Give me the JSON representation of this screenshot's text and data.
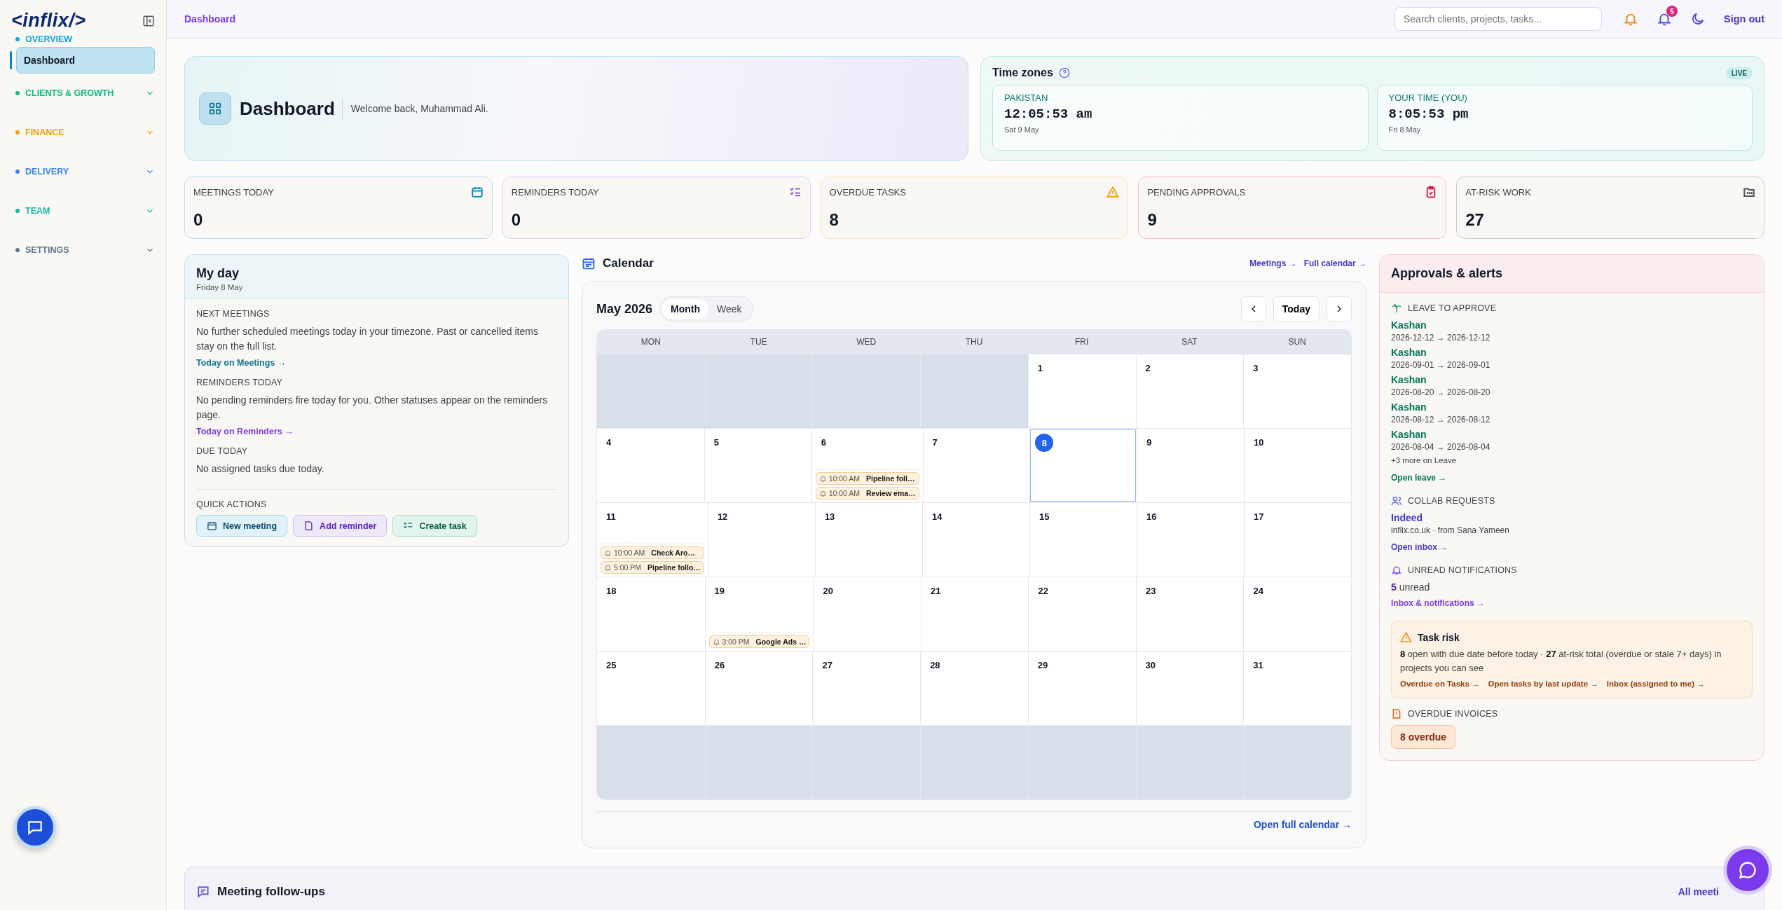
{
  "sidebar": {
    "logo": "<inflix/>",
    "sections": [
      {
        "label": "OVERVIEW",
        "color": "#0ea5e9",
        "expanded": true,
        "items": [
          {
            "label": "Dashboard",
            "selected": true
          }
        ]
      },
      {
        "label": "CLIENTS & GROWTH",
        "color": "#10b981",
        "expanded": false
      },
      {
        "label": "FINANCE",
        "color": "#f59e0b",
        "expanded": false
      },
      {
        "label": "DELIVERY",
        "color": "#3b82f6",
        "expanded": false
      },
      {
        "label": "TEAM",
        "color": "#14b8a6",
        "expanded": false
      },
      {
        "label": "SETTINGS",
        "color": "#64748b",
        "expanded": false
      }
    ]
  },
  "header": {
    "breadcrumb": "Dashboard",
    "search": {
      "placeholder": "Search clients, projects, tasks..."
    },
    "notification_count": "5",
    "sign_out": "Sign out"
  },
  "hero": {
    "title": "Dashboard",
    "subtitle": "Welcome back, Muhammad Ali."
  },
  "time_zones": {
    "title": "Time zones",
    "badge": "LIVE",
    "zones": [
      {
        "label": "PAKISTAN",
        "time": "12:05:53 am",
        "date": "Sat 9 May"
      },
      {
        "label": "YOUR TIME (YOU)",
        "time": "8:05:53 pm",
        "date": "Fri 8 May"
      }
    ]
  },
  "stats": [
    {
      "label": "MEETINGS TODAY",
      "value": "0",
      "kind": "calendar",
      "color": "#0891b2"
    },
    {
      "label": "REMINDERS TODAY",
      "value": "0",
      "kind": "checklist",
      "color": "#8b5cf6"
    },
    {
      "label": "OVERDUE TASKS",
      "value": "8",
      "kind": "warning",
      "color": "#f59e0b"
    },
    {
      "label": "PENDING APPROVALS",
      "value": "9",
      "kind": "clipboard",
      "color": "#e11d48"
    },
    {
      "label": "AT-RISK WORK",
      "value": "27",
      "kind": "folder",
      "color": "#52525b"
    }
  ],
  "my_day": {
    "title": "My day",
    "date": "Friday 8 May",
    "sections": [
      {
        "kind": "meetings",
        "heading": "NEXT MEETINGS",
        "text": "No further scheduled meetings today in your timezone. Past or cancelled items stay on the full list.",
        "link": "Today on Meetings →"
      },
      {
        "kind": "reminders",
        "heading": "REMINDERS TODAY",
        "text": "No pending reminders fire today for you. Other statuses appear on the reminders page.",
        "link": "Today on Reminders →"
      },
      {
        "heading": "DUE TODAY",
        "text": "No assigned tasks due today."
      }
    ],
    "quick_actions": {
      "heading": "QUICK ACTIONS",
      "buttons": [
        {
          "label": "New meeting",
          "kind": "meeting"
        },
        {
          "label": "Add reminder",
          "kind": "reminder"
        },
        {
          "label": "Create task",
          "kind": "task"
        }
      ]
    }
  },
  "calendar": {
    "title": "Calendar",
    "links": [
      "Meetings →",
      "Full calendar →"
    ],
    "month": "May 2026",
    "views": [
      {
        "label": "Month",
        "selected": true
      },
      {
        "label": "Week",
        "selected": false
      }
    ],
    "today_button": "Today",
    "weekdays": [
      "MON",
      "TUE",
      "WED",
      "THU",
      "FRI",
      "SAT",
      "SUN"
    ],
    "weeks": [
      [
        {
          "outside": true
        },
        {
          "outside": true
        },
        {
          "outside": true
        },
        {
          "outside": true
        },
        {
          "day": "1",
          "today": false
        },
        {
          "day": "2",
          "today": false
        },
        {
          "day": "3",
          "today": false
        }
      ],
      [
        {
          "day": "4",
          "today": false
        },
        {
          "day": "5",
          "today": false
        },
        {
          "day": "6",
          "today": false,
          "events": [
            {
              "time": "10:00 AM",
              "title": "Pipeline foll…"
            },
            {
              "time": "10:00 AM",
              "title": "Review ema…"
            }
          ]
        },
        {
          "day": "7",
          "today": false
        },
        {
          "day": "8",
          "today": true
        },
        {
          "day": "9",
          "today": false
        },
        {
          "day": "10",
          "today": false
        }
      ],
      [
        {
          "day": "11",
          "today": false,
          "events": [
            {
              "time": "10:00 AM",
              "title": "Check Aro…"
            },
            {
              "time": "5:00 PM",
              "title": "Pipeline follo…"
            }
          ]
        },
        {
          "day": "12",
          "today": false
        },
        {
          "day": "13",
          "today": false
        },
        {
          "day": "14",
          "today": false
        },
        {
          "day": "15",
          "today": false
        },
        {
          "day": "16",
          "today": false
        },
        {
          "day": "17",
          "today": false
        }
      ],
      [
        {
          "day": "18",
          "today": false
        },
        {
          "day": "19",
          "today": false,
          "events": [
            {
              "time": "3:00 PM",
              "title": "Google Ads …"
            }
          ]
        },
        {
          "day": "20",
          "today": false
        },
        {
          "day": "21",
          "today": false
        },
        {
          "day": "22",
          "today": false
        },
        {
          "day": "23",
          "today": false
        },
        {
          "day": "24",
          "today": false
        }
      ],
      [
        {
          "day": "25",
          "today": false
        },
        {
          "day": "26",
          "today": false
        },
        {
          "day": "27",
          "today": false
        },
        {
          "day": "28",
          "today": false
        },
        {
          "day": "29",
          "today": false
        },
        {
          "day": "30",
          "today": false
        },
        {
          "day": "31",
          "today": false
        }
      ],
      [
        {
          "outside": true
        },
        {
          "outside": true
        },
        {
          "outside": true
        },
        {
          "outside": true
        },
        {
          "outside": true
        },
        {
          "outside": true
        },
        {
          "outside": true
        }
      ]
    ],
    "footer_link": "Open full calendar →"
  },
  "approvals": {
    "title": "Approvals & alerts",
    "leave": {
      "heading": "LEAVE TO APPROVE",
      "items": [
        {
          "name": "Kashan",
          "range": "2026-12-12 → 2026-12-12"
        },
        {
          "name": "Kashan",
          "range": "2026-09-01 → 2026-09-01"
        },
        {
          "name": "Kashan",
          "range": "2026-08-20 → 2026-08-20"
        },
        {
          "name": "Kashan",
          "range": "2026-08-12 → 2026-08-12"
        },
        {
          "name": "Kashan",
          "range": "2026-08-04 → 2026-08-04"
        }
      ],
      "more": "+3 more on Leave",
      "link": "Open leave →"
    },
    "collab": {
      "heading": "COLLAB REQUESTS",
      "name": "Indeed",
      "detail": "inflix.co.uk · from Sana Yameen",
      "link": "Open inbox →"
    },
    "notifications": {
      "heading": "UNREAD NOTIFICATIONS",
      "count": "**5** unread",
      "link": "Inbox & notifications →"
    },
    "task_risk": {
      "title": "Task risk",
      "text": "**8** open with due date before today · **27** at-risk total (overdue or stale 7+ days) in projects you can see",
      "links": [
        "Overdue on Tasks →",
        "Open tasks by last update →",
        "Inbox (assigned to me) →"
      ]
    },
    "invoices": {
      "heading": "OVERDUE INVOICES",
      "badge": "8 overdue"
    }
  },
  "follow_ups": {
    "title": "Meeting follow-ups",
    "link": "All meeti"
  }
}
